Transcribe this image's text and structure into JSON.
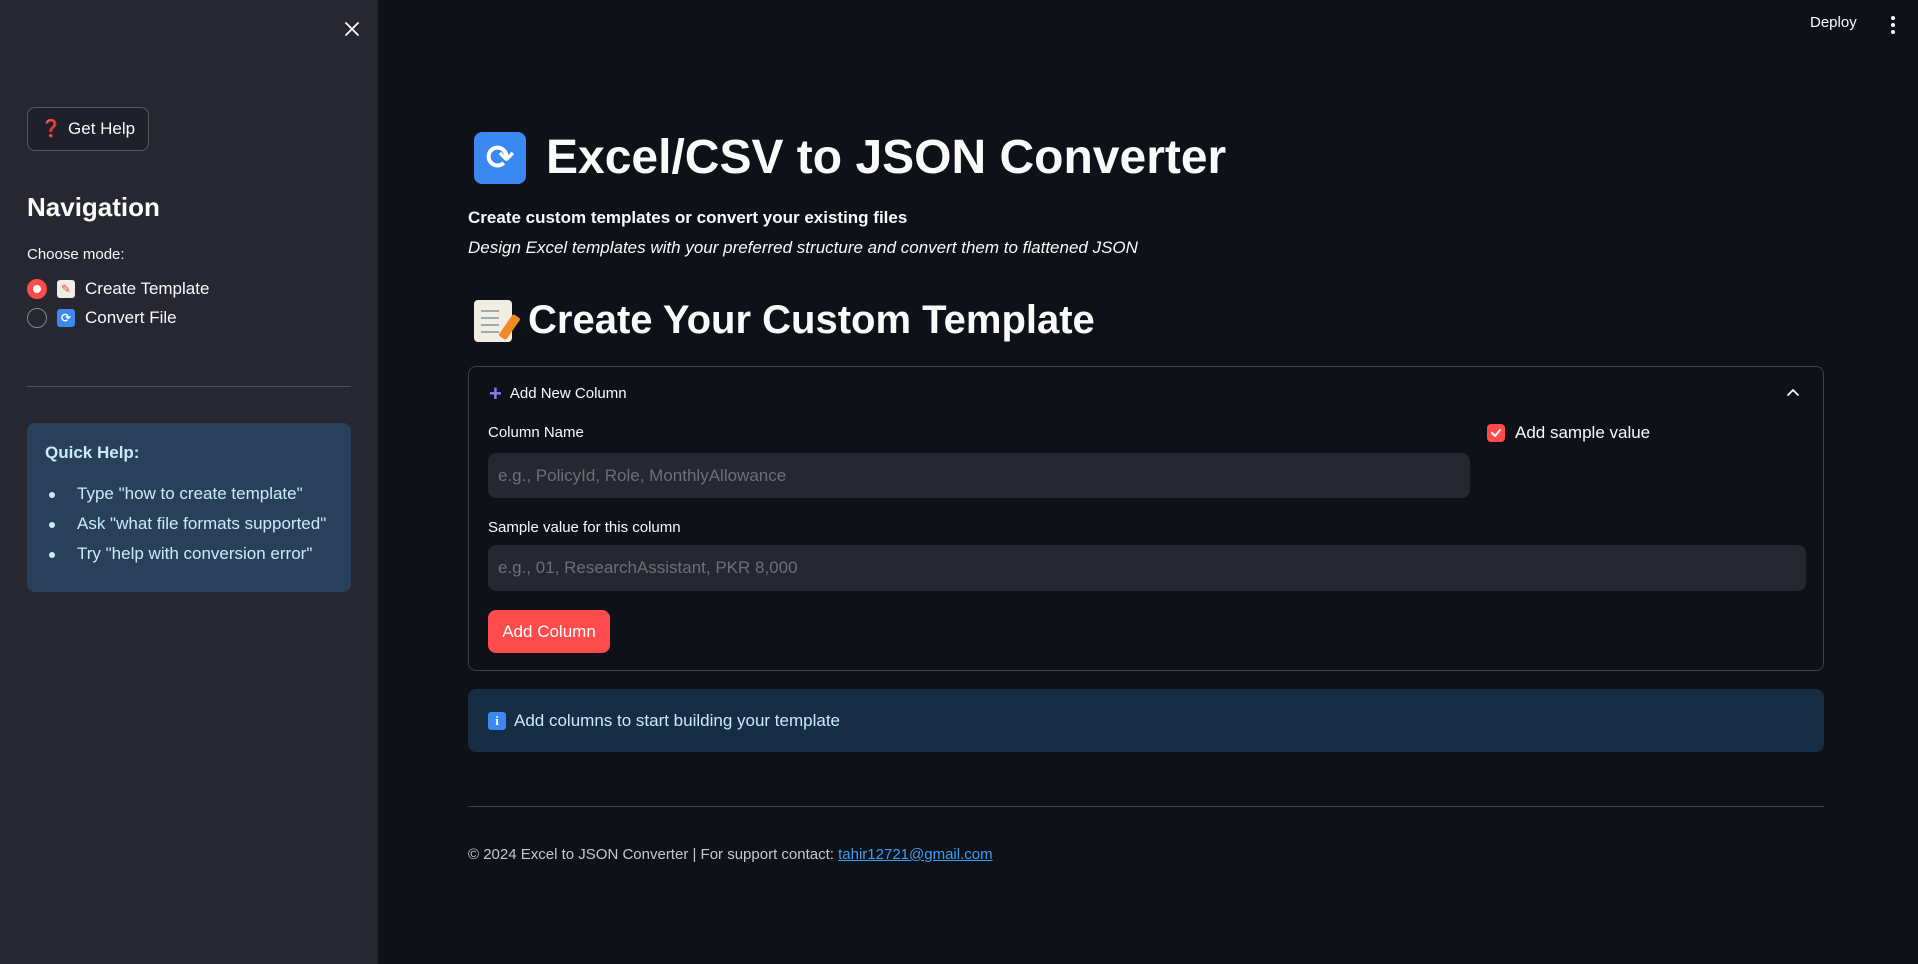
{
  "sidebar": {
    "help_button_label": "Get Help",
    "nav_title": "Navigation",
    "choose_label": "Choose mode:",
    "modes": [
      {
        "label": "Create Template",
        "selected": true,
        "icon": "memo-icon"
      },
      {
        "label": "Convert File",
        "selected": false,
        "icon": "cycle-icon"
      }
    ],
    "quick_help": {
      "title": "Quick Help:",
      "items": [
        "Type \"how to create template\"",
        "Ask \"what file formats supported\"",
        "Try \"help with conversion error\""
      ]
    }
  },
  "header": {
    "deploy_label": "Deploy"
  },
  "main": {
    "title": "Excel/CSV to JSON Converter",
    "subtitle_bold": "Create custom templates or convert your existing files",
    "subtitle_italic": "Design Excel templates with your preferred structure and convert them to flattened JSON",
    "section_title": "Create Your Custom Template",
    "expander": {
      "header": "Add New Column",
      "column_name_label": "Column Name",
      "column_name_placeholder": "e.g., PolicyId, Role, MonthlyAllowance",
      "column_name_value": "",
      "sample_checkbox_label": "Add sample value",
      "sample_checkbox_checked": true,
      "sample_value_label": "Sample value for this column",
      "sample_value_placeholder": "e.g., 01, ResearchAssistant, PKR 8,000",
      "sample_value_value": "",
      "add_button_label": "Add Column"
    },
    "info_message": "Add columns to start building your template"
  },
  "footer": {
    "text": "© 2024 Excel to JSON Converter | For support contact: ",
    "email": "tahir12721@gmail.com"
  },
  "colors": {
    "accent": "#ff4b4b",
    "background": "#0e1117",
    "sidebar": "#262730",
    "info_bg": "#172d43",
    "link": "#3d9df3"
  }
}
